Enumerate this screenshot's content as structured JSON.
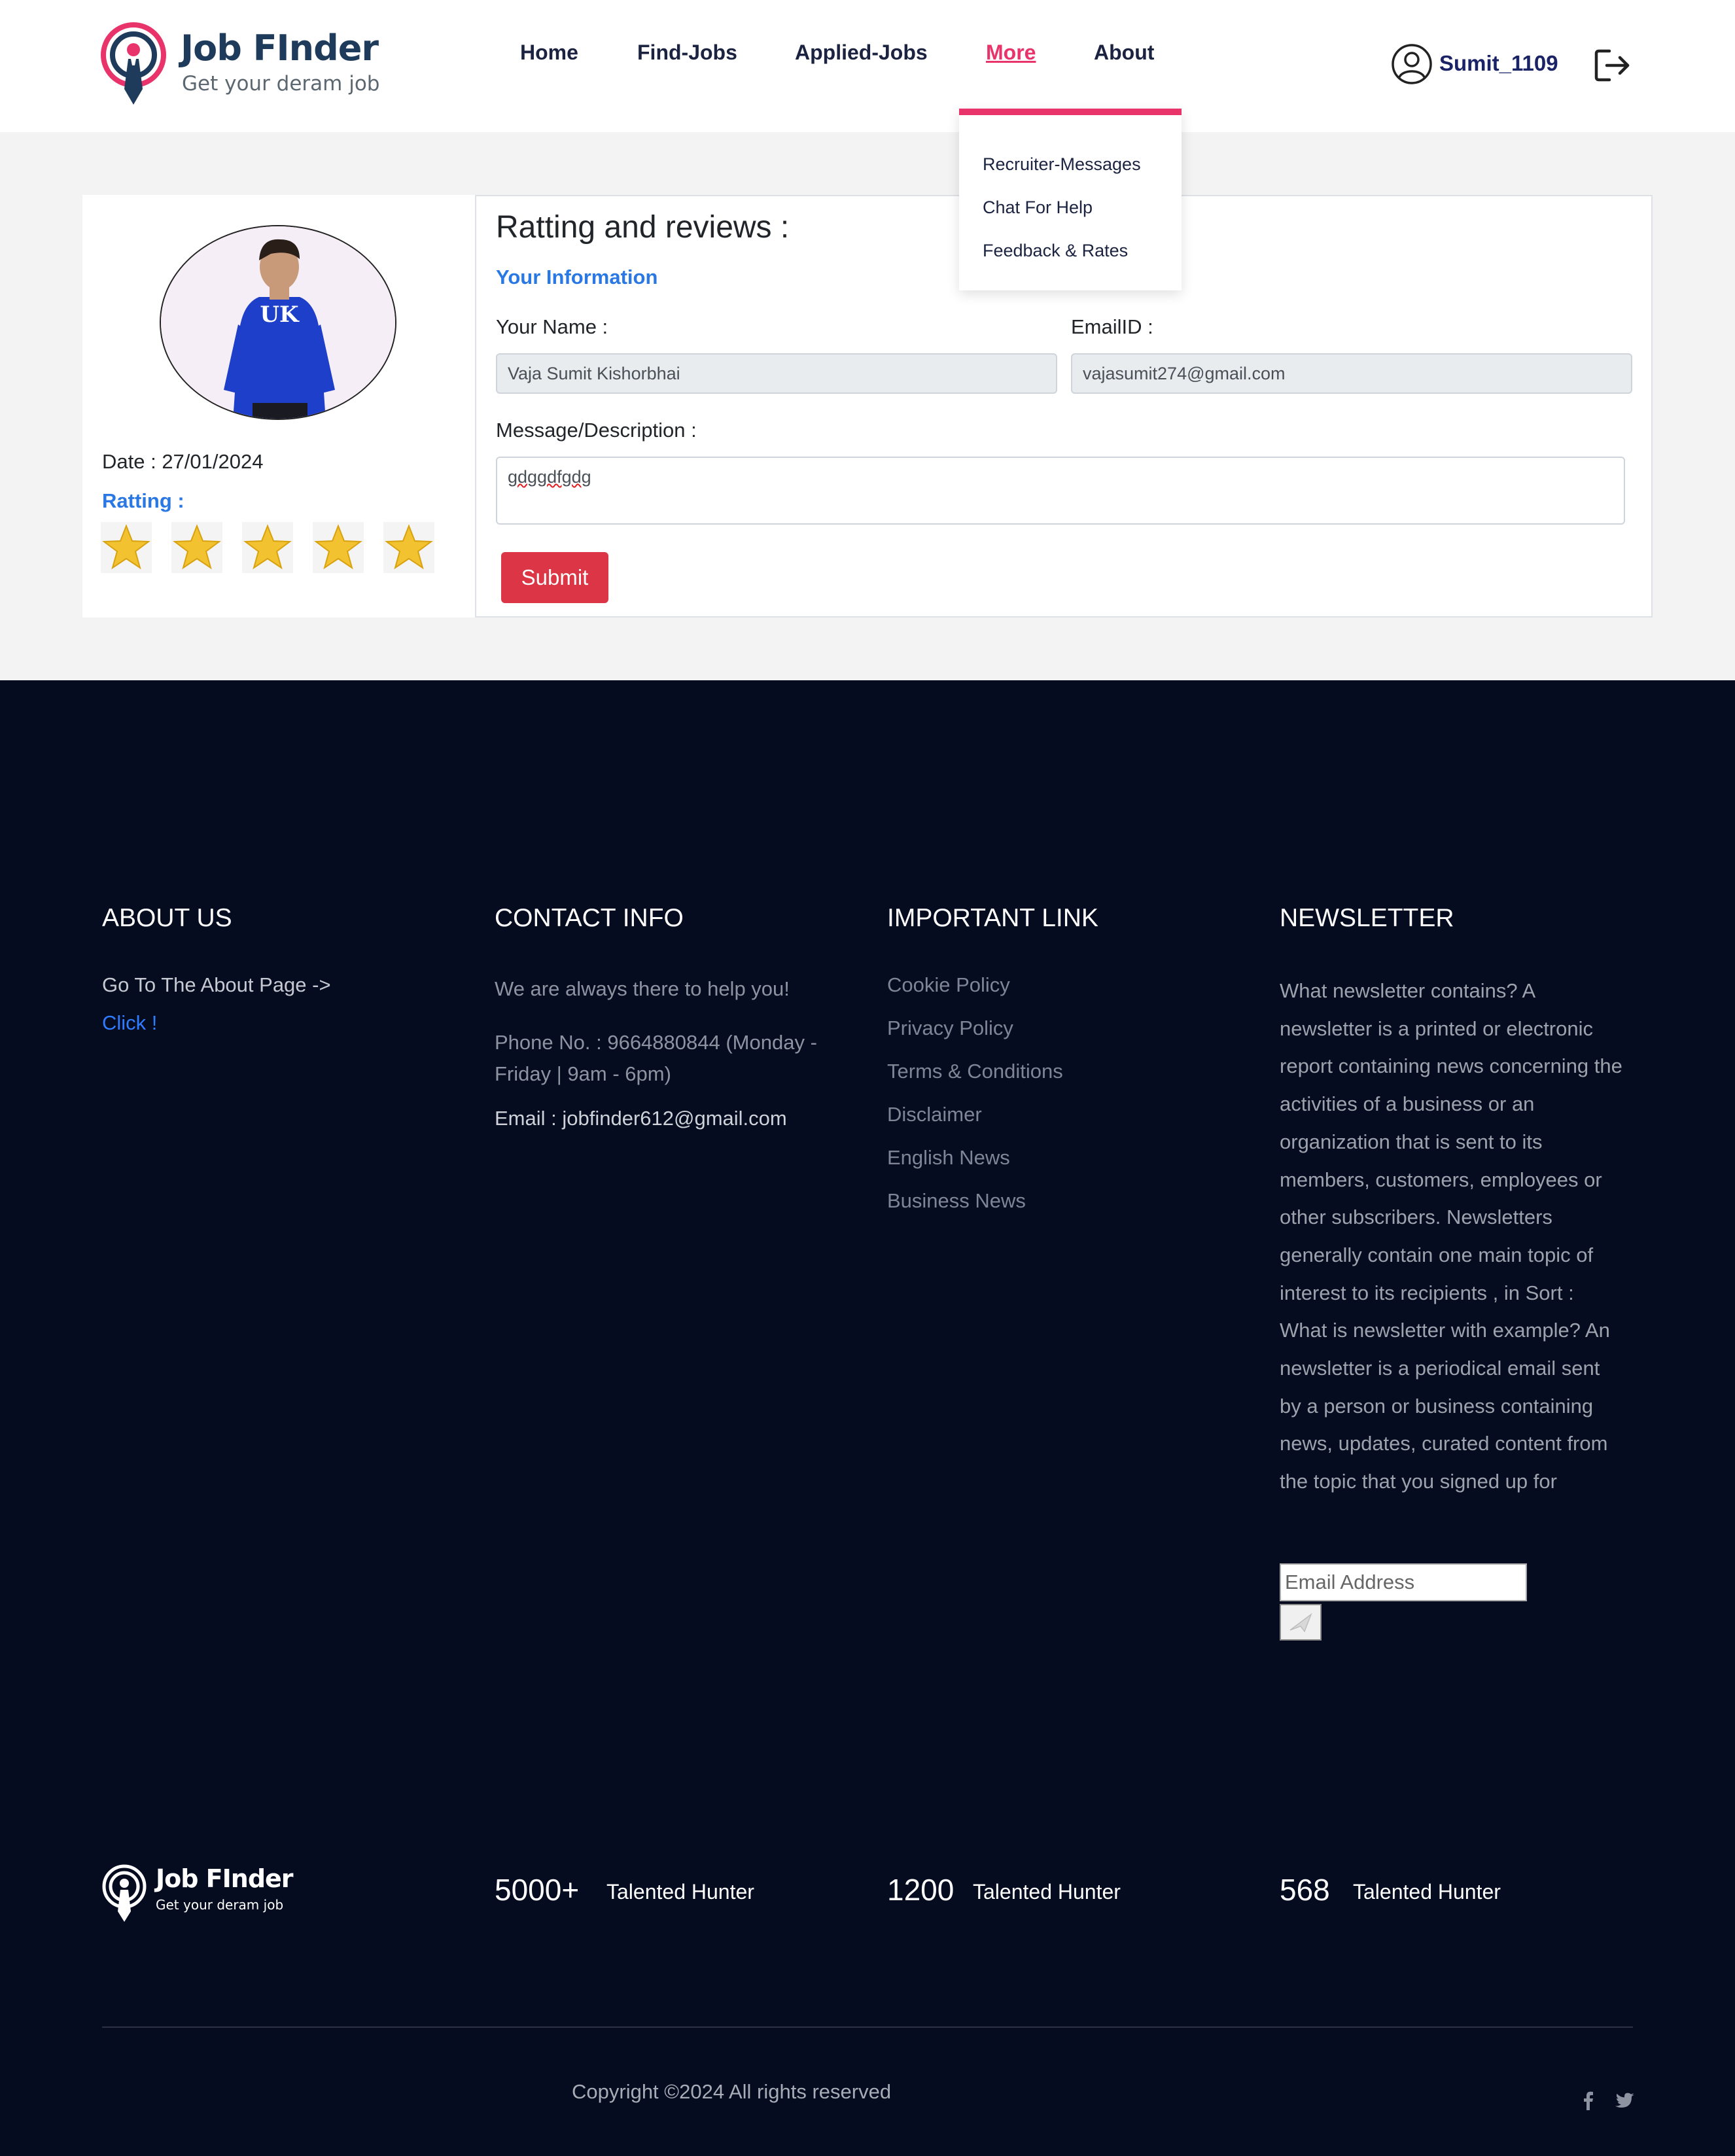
{
  "header": {
    "logo_title": "Job FInder",
    "logo_subtitle": "Get your deram job",
    "nav": [
      {
        "label": "Home"
      },
      {
        "label": "Find-Jobs"
      },
      {
        "label": "Applied-Jobs"
      },
      {
        "label": "More",
        "active": true
      },
      {
        "label": "About"
      }
    ],
    "username": "Sumit_1109",
    "accent_color": "#e8336b"
  },
  "dropdown": {
    "items": [
      "Recruiter-Messages",
      "Chat For Help",
      "Feedback & Rates"
    ]
  },
  "profile": {
    "date": "Date : 27/01/2024",
    "rating_label": "Ratting :",
    "rating_value": 5,
    "rating_max": 5
  },
  "form": {
    "title": "Ratting and reviews :",
    "subtitle": "Your Information",
    "name_label": "Your Name :",
    "name_value": "Vaja Sumit Kishorbhai",
    "email_label": "EmailID :",
    "email_value": "vajasumit274@gmail.com",
    "message_label": "Message/Description :",
    "message_value": "gdggdfgdg",
    "submit_label": "Submit",
    "submit_color": "#dc3545"
  },
  "footer": {
    "about": {
      "title": "ABOUT US",
      "text": "Go To The About Page ->",
      "link": "Click !"
    },
    "contact": {
      "title": "CONTACT INFO",
      "tagline": "We are always there to help you!",
      "phone": "Phone No. : 9664880844 (Monday - Friday | 9am - 6pm)",
      "email": "Email : jobfinder612@gmail.com"
    },
    "links": {
      "title": "IMPORTANT LINK",
      "items": [
        "Cookie Policy",
        "Privacy Policy",
        "Terms & Conditions",
        "Disclaimer",
        "English News",
        "Business News"
      ]
    },
    "newsletter": {
      "title": "NEWSLETTER",
      "text": "What newsletter contains? A newsletter is a printed or electronic report containing news concerning the activities of a business or an organization that is sent to its members, customers, employees or other subscribers. Newsletters generally contain one main topic of interest to its recipients , in Sort : What is newsletter with example? An newsletter is a periodical email sent by a person or business containing news, updates, curated content from the topic that you signed up for",
      "email_placeholder": "Email Address",
      "send_icon": "send-icon"
    },
    "logo_title": "Job FInder",
    "logo_subtitle": "Get your deram job",
    "stats": [
      {
        "number": "5000+",
        "label": "Talented Hunter"
      },
      {
        "number": "1200",
        "label": "Talented Hunter"
      },
      {
        "number": "568",
        "label": "Talented Hunter"
      }
    ],
    "copyright": "Copyright ©2024 All rights reserved",
    "social": [
      "facebook-icon",
      "twitter-icon"
    ],
    "background": "#050c1f"
  }
}
